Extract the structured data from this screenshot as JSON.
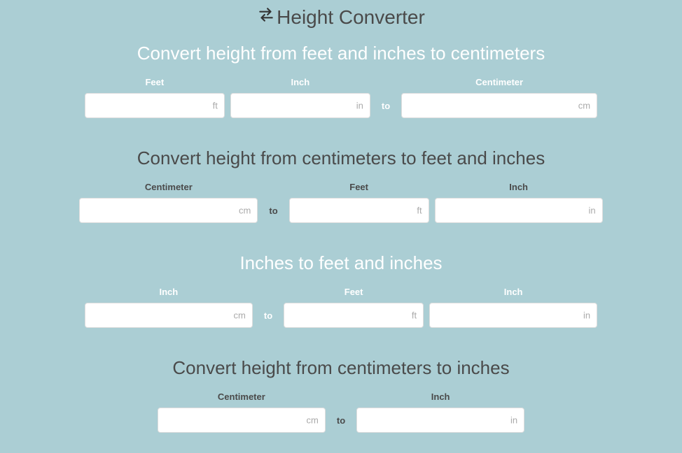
{
  "header": {
    "title": "Height Converter",
    "icon": "swap-horizontal-icon"
  },
  "sections": {
    "ft_in_to_cm": {
      "title": "Convert height from feet and inches to centimeters",
      "feet_label": "Feet",
      "feet_unit": "ft",
      "feet_value": "",
      "inch_label": "Inch",
      "inch_unit": "in",
      "inch_value": "",
      "to_label": "to",
      "cm_label": "Centimeter",
      "cm_unit": "cm",
      "cm_value": ""
    },
    "cm_to_ft_in": {
      "title": "Convert height from centimeters to feet and inches",
      "cm_label": "Centimeter",
      "cm_unit": "cm",
      "cm_value": "",
      "to_label": "to",
      "feet_label": "Feet",
      "feet_unit": "ft",
      "feet_value": "",
      "inch_label": "Inch",
      "inch_unit": "in",
      "inch_value": ""
    },
    "in_to_ft_in": {
      "title": "Inches to feet and inches",
      "in_label": "Inch",
      "in_unit": "cm",
      "in_value": "",
      "to_label": "to",
      "feet_label": "Feet",
      "feet_unit": "ft",
      "feet_value": "",
      "inch_label": "Inch",
      "inch_unit": "in",
      "inch_value": ""
    },
    "cm_to_in": {
      "title": "Convert height from centimeters to inches",
      "cm_label": "Centimeter",
      "cm_unit": "cm",
      "cm_value": "",
      "to_label": "to",
      "inch_label": "Inch",
      "inch_unit": "in",
      "inch_value": ""
    }
  }
}
